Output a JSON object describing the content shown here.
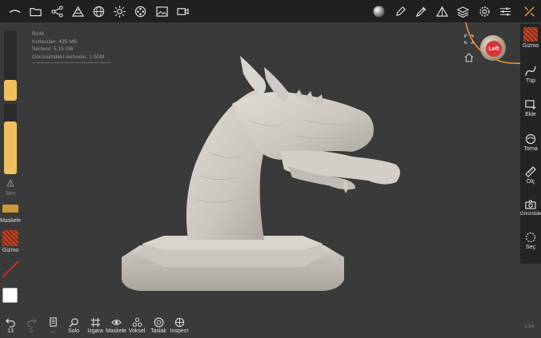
{
  "top_toolbar": {
    "icons": [
      "app-logo-icon",
      "folder-icon",
      "share-nodes-icon",
      "layers-triangle-icon",
      "sphere-grid-icon",
      "sun-icon",
      "film-reel-icon",
      "image-icon",
      "video-camera-icon",
      "material-ball-icon",
      "pencil-icon",
      "eyedropper-icon",
      "triangle-icon",
      "stack-icon",
      "gear-icon",
      "sliders-icon",
      "tools-icon"
    ]
  },
  "ram": {
    "title": "RAM",
    "used": "Kullanılan: 435 MB",
    "free": "Serbest: 5.15 GB",
    "visible_vertices": "Görünümdeki vertexler: 1.50M"
  },
  "left_panel": {
    "slider1_level": 0.3,
    "slider2_level": 0.75,
    "sym_label": "Sim",
    "mask_label": "Maskele",
    "gizmo_label": "Gizmo",
    "colors": {
      "accent": "#f0c060",
      "material": "#a8361f",
      "paint": "#ffffff"
    }
  },
  "gizmo": {
    "face_label": "Left",
    "orbit_color": "#e8943a"
  },
  "right_panel": {
    "items": [
      {
        "label": "Gizmo",
        "icon": "material-swatch-icon"
      },
      {
        "label": "Tüp",
        "icon": "curve-icon"
      },
      {
        "label": "Ekle",
        "icon": "add-window-icon"
      },
      {
        "label": "Torna",
        "icon": "lathe-icon"
      },
      {
        "label": "Ölç",
        "icon": "ruler-icon"
      },
      {
        "label": "Görüntüle",
        "icon": "camera-icon"
      },
      {
        "label": "Seç",
        "icon": "dashed-circle-icon"
      }
    ]
  },
  "bottom_bar": {
    "undo_count": "13",
    "redo_count": "0",
    "items": [
      {
        "label": "...",
        "icon": "info-card-icon"
      },
      {
        "label": "Solo",
        "icon": "magnifier-icon"
      },
      {
        "label": "Izgara",
        "icon": "grid-icon"
      },
      {
        "label": "Maskele",
        "icon": "eye-icon"
      },
      {
        "label": "Voksel",
        "icon": "voxel-icon"
      },
      {
        "label": "Taslak",
        "icon": "globe-icon"
      },
      {
        "label": "Inspect",
        "icon": "inspect-icon"
      }
    ],
    "version": "1.84"
  }
}
